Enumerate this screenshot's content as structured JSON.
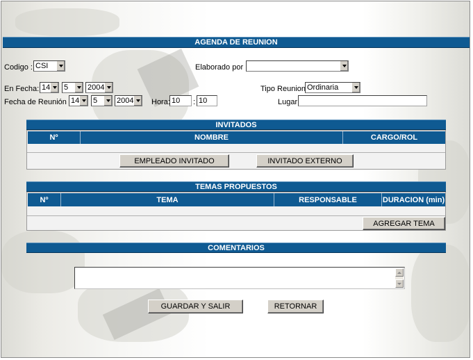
{
  "header": {
    "title": "AGENDA DE REUNION"
  },
  "form": {
    "codigo_label": "Codigo :",
    "codigo_value": "CSI",
    "elaborado_label": "Elaborado por :",
    "elaborado_value": "",
    "en_fecha_label": "En Fecha:",
    "en_fecha": {
      "day": "14",
      "month": "5",
      "year": "2004"
    },
    "tipo_label": "Tipo Reunion:",
    "tipo_value": "Ordinaria",
    "fecha_reunion_label": "Fecha de Reunión :",
    "fecha_reunion": {
      "day": "14",
      "month": "5",
      "year": "2004"
    },
    "hora_label": "Hora:",
    "hora_h": "10",
    "hora_sep": ":",
    "hora_m": "10",
    "lugar_label": "Lugar:",
    "lugar_value": ""
  },
  "invitados": {
    "title": "INVITADOS",
    "columns": [
      "Nº",
      "NOMBRE",
      "CARGO/ROL"
    ],
    "btn_empleado": "EMPLEADO INVITADO",
    "btn_externo": "INVITADO EXTERNO"
  },
  "temas": {
    "title": "TEMAS PROPUESTOS",
    "columns": [
      "Nº",
      "TEMA",
      "RESPONSABLE",
      "DURACION (min)"
    ],
    "btn_agregar": "AGREGAR TEMA"
  },
  "comentarios": {
    "title": "COMENTARIOS",
    "value": ""
  },
  "actions": {
    "guardar": "GUARDAR Y SALIR",
    "retornar": "RETORNAR"
  }
}
